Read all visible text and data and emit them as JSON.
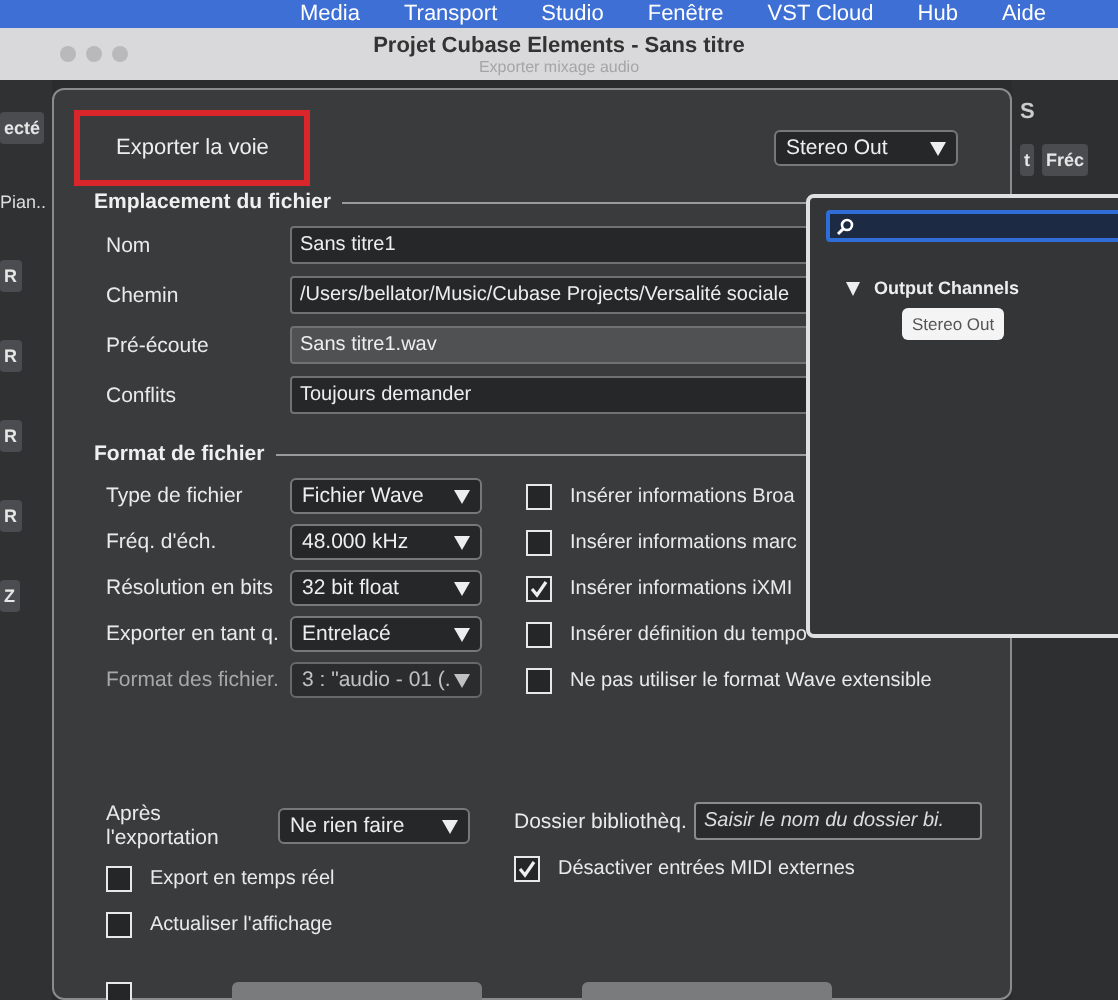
{
  "menu_bar": {
    "items": [
      "Media",
      "Transport",
      "Studio",
      "Fenêtre",
      "VST Cloud",
      "Hub",
      "Aide"
    ]
  },
  "window": {
    "title": "Projet Cubase Elements - Sans titre",
    "subtitle": "Exporter mixage audio"
  },
  "left_strip": {
    "items": [
      {
        "kind": "button",
        "label": "ecté"
      },
      {
        "kind": "text",
        "label": "Pian.."
      },
      {
        "kind": "button",
        "label": "R"
      },
      {
        "kind": "button",
        "label": "R"
      },
      {
        "kind": "button",
        "label": "R"
      },
      {
        "kind": "button",
        "label": "R"
      },
      {
        "kind": "button",
        "label": "Z"
      }
    ]
  },
  "right_strip": {
    "heading": "S",
    "buttons": [
      "t",
      "Fréc"
    ]
  },
  "dialog": {
    "export_mode": {
      "label": "Exporter la voie",
      "highlighted": true
    },
    "channel_select": {
      "value": "Stereo Out"
    },
    "file_location": {
      "title": "Emplacement du fichier",
      "fields": [
        {
          "label": "Nom",
          "value": "Sans titre1",
          "kind": "input"
        },
        {
          "label": "Chemin",
          "value": "/Users/bellator/Music/Cubase Projects/Versalité sociale",
          "kind": "input"
        },
        {
          "label": "Pré-écoute",
          "value": "Sans titre1.wav",
          "kind": "readonly"
        },
        {
          "label": "Conflits",
          "value": "Toujours demander",
          "kind": "select"
        }
      ]
    },
    "file_format": {
      "title": "Format de fichier",
      "selects": [
        {
          "label": "Type de fichier",
          "value": "Fichier Wave",
          "disabled": false
        },
        {
          "label": "Fréq. d'éch.",
          "value": "48.000 kHz",
          "disabled": false
        },
        {
          "label": "Résolution en bits",
          "value": "32 bit float",
          "disabled": false
        },
        {
          "label": "Exporter en tant q.",
          "value": "Entrelacé",
          "disabled": false
        },
        {
          "label": "Format des fichier.",
          "value": "3 : \"audio - 01 (.",
          "disabled": true
        }
      ],
      "options": [
        {
          "label": "Insérer informations Broa",
          "checked": false
        },
        {
          "label": "Insérer informations marc",
          "checked": false
        },
        {
          "label": "Insérer informations iXMI",
          "checked": true
        },
        {
          "label": "Insérer définition du tempo",
          "checked": false
        },
        {
          "label": "Ne pas utiliser le format Wave extensible",
          "checked": false
        }
      ]
    },
    "after_export": {
      "label": "Après l'exportation",
      "value": "Ne rien faire"
    },
    "library_folder": {
      "label": "Dossier bibliothèq.",
      "placeholder": "Saisir le nom du dossier bi."
    },
    "options": [
      {
        "label": "Export en temps réel",
        "checked": false
      },
      {
        "label": "Actualiser l'affichage",
        "checked": false
      },
      {
        "label": "Désactiver entrées MIDI externes",
        "checked": true
      }
    ],
    "bottom_checkbox": {
      "checked": false
    }
  },
  "channel_popup": {
    "group": {
      "label": "Output Channels",
      "expanded": true,
      "items": [
        {
          "label": "Stereo Out",
          "selected": true
        }
      ]
    }
  }
}
